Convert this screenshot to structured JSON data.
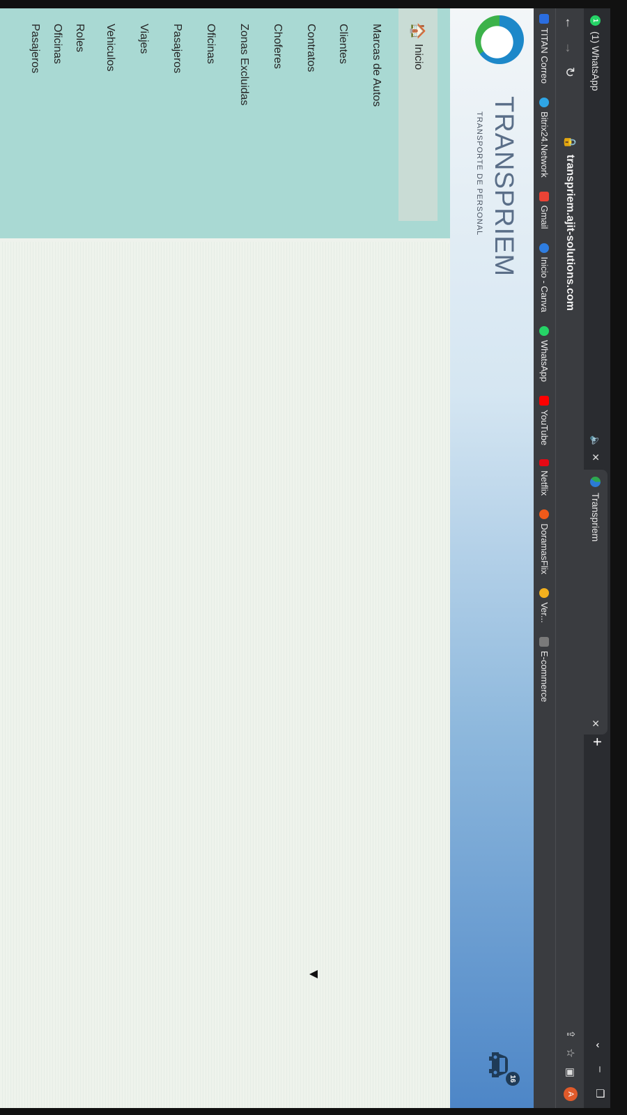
{
  "tabs": [
    {
      "title": "(1) WhatsApp",
      "badge": "1"
    },
    {
      "title": "Transpriem"
    }
  ],
  "addressbar": {
    "url": "transpriem.ajit-solutions.com",
    "avatar_letter": "A"
  },
  "bookmarks": [
    {
      "label": "TITAN Correo",
      "color": "#2a6de0"
    },
    {
      "label": "Bitrix24.Network",
      "color": "#2fa6e6"
    },
    {
      "label": "Gmail",
      "color": "#ea4335"
    },
    {
      "label": "Inicio - Canva",
      "color": "#2e7de0"
    },
    {
      "label": "WhatsApp",
      "color": "#25d366"
    },
    {
      "label": "YouTube",
      "color": "#ff0000"
    },
    {
      "label": "Netflix",
      "color": "#e50914"
    },
    {
      "label": "DoramasFlix",
      "color": "#f05a1a"
    },
    {
      "label": "Ver...",
      "color": "#f2b01e"
    },
    {
      "label": "E-commerce",
      "color": "#7a7a7a"
    }
  ],
  "header": {
    "brand": "TRANSPRIEM",
    "tagline": "TRANSPORTE DE PERSONAL",
    "notification_count": "16"
  },
  "sidebar": {
    "items": [
      {
        "label": "Inicio"
      },
      {
        "label": "Marcas de Autos"
      },
      {
        "label": "Clientes"
      },
      {
        "label": "Contratos"
      },
      {
        "label": "Choferes"
      },
      {
        "label": "Zonas Excluidas"
      },
      {
        "label": "Oficinas"
      },
      {
        "label": "Pasajeros"
      },
      {
        "label": "Viajes"
      },
      {
        "label": "Vehiculos"
      },
      {
        "label": "Roles"
      },
      {
        "label": "Oficinas"
      },
      {
        "label": "Pasajeros"
      }
    ]
  },
  "colors": {
    "sidebar_bg": "#a9d9d3",
    "browser_chrome": "#3a3c40"
  }
}
